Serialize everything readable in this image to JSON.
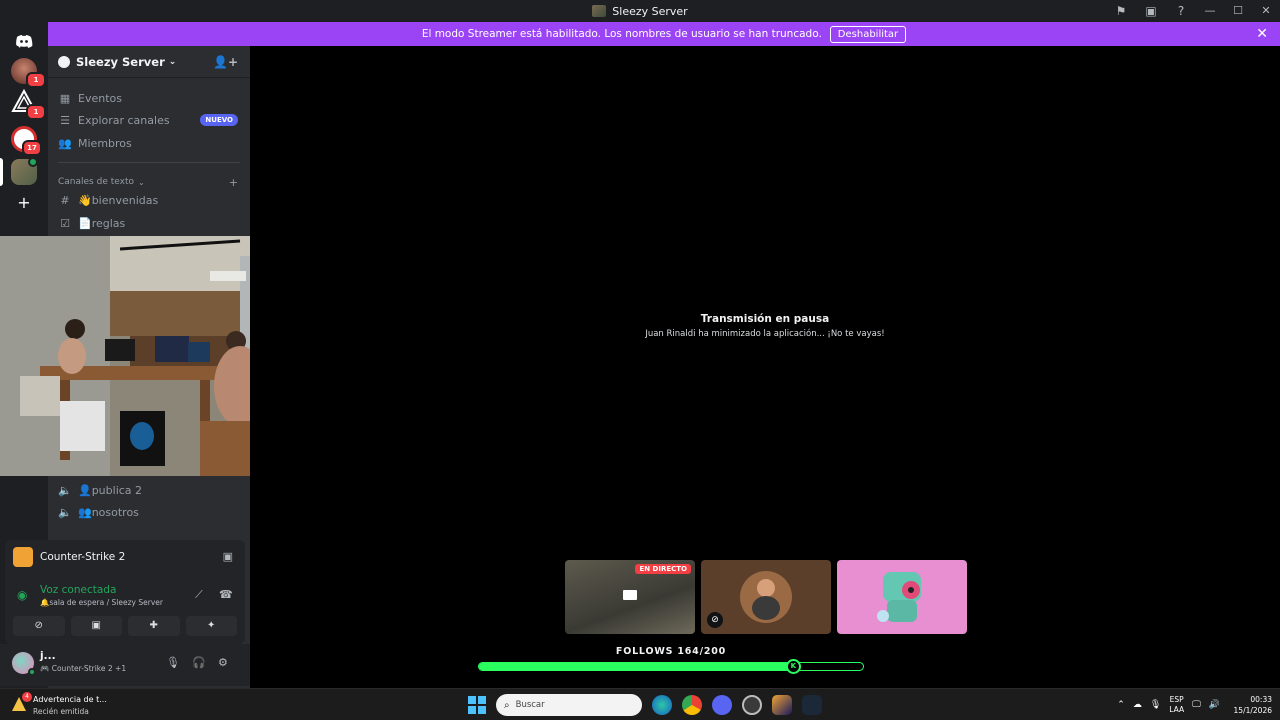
{
  "window": {
    "title": "Sleezy Server"
  },
  "banner": {
    "text": "El modo Streamer está habilitado. Los nombres de usuario se han truncado.",
    "button": "Deshabilitar"
  },
  "rail": {
    "badges": [
      "1",
      "1",
      "17"
    ]
  },
  "server": {
    "name": "Sleezy Server",
    "nav": [
      {
        "icon": "calendar-icon",
        "label": "Eventos"
      },
      {
        "icon": "browse-channels-icon",
        "label": "Explorar canales",
        "badge": "NUEVO"
      },
      {
        "icon": "members-icon",
        "label": "Miembros"
      }
    ],
    "category": "Canales de texto",
    "text_channels": [
      {
        "label": "👋bienvenidas"
      },
      {
        "label": "📄reglas"
      }
    ],
    "voice_channels": [
      {
        "label": "👤publica 2"
      },
      {
        "label": "👥nosotros"
      }
    ]
  },
  "voice": {
    "activity": "Counter-Strike 2",
    "status": "Voz conectada",
    "location": "🔔sala de espera / Sleezy Server"
  },
  "user": {
    "name": "j...",
    "activity": "Counter-Strike 2",
    "extra": "+1"
  },
  "stream": {
    "heading": "Transmisión en pausa",
    "subtext": "Juan Rinaldi ha minimizado la aplicación... ¡No te vayas!",
    "live_label": "EN DIRECTO"
  },
  "follows": {
    "label": "FOLLOWS 164/200",
    "current": 164,
    "goal": 200,
    "knob_letter": "K"
  },
  "taskbar": {
    "notification_title": "Advertencia de t...",
    "notification_sub": "Recién emitida",
    "notification_count": "4",
    "search_placeholder": "Buscar",
    "lang_1": "ESP",
    "lang_2": "LAA",
    "time": "00:33",
    "date": "15/1/2026"
  },
  "colors": {
    "banner": "#9b44f6",
    "sidebar": "#2b2d31",
    "rail": "#1e1f22",
    "progress": "#2bff5f",
    "live": "#f23f43"
  }
}
